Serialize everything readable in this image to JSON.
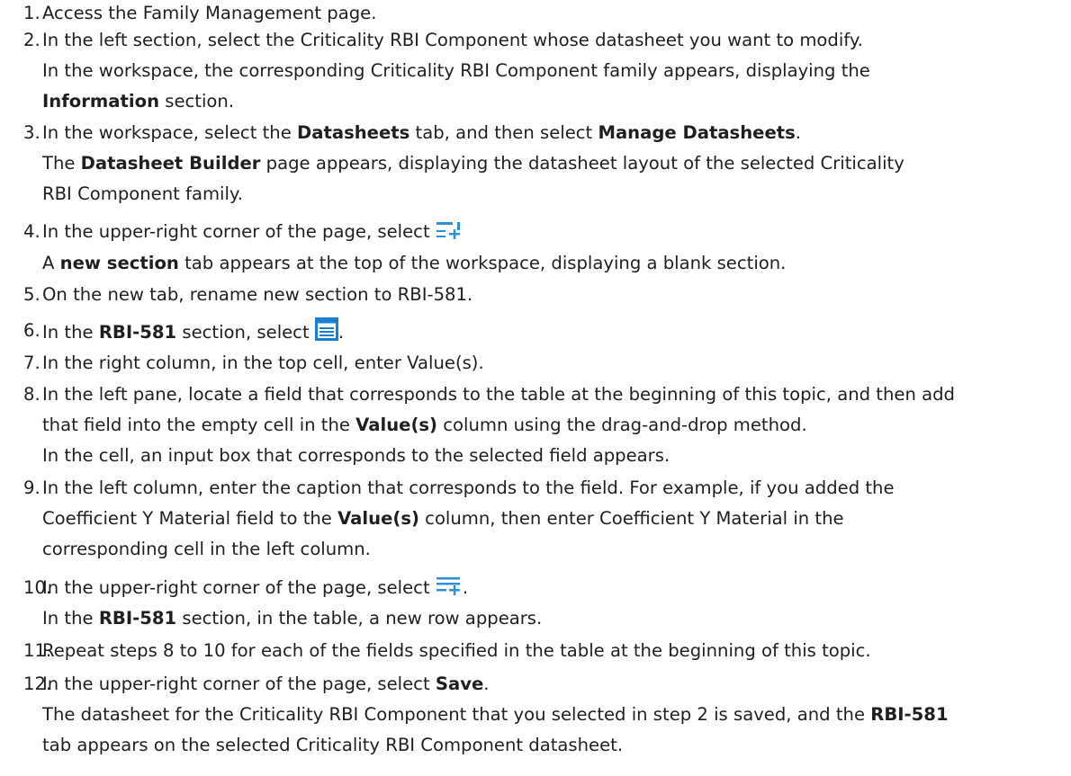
{
  "steps": [
    {
      "number": "1.",
      "lines": [
        [
          {
            "t": "Access the Family Management page."
          }
        ]
      ]
    },
    {
      "number": "2.",
      "lines": [
        [
          {
            "t": "In the left section, select the Criticality RBI Component whose datasheet you want to modify."
          }
        ],
        [
          {
            "t": "In the workspace, the corresponding Criticality RBI Component family appears, displaying the"
          }
        ],
        [
          {
            "t": "Information",
            "b": true
          },
          {
            "t": " section."
          }
        ]
      ]
    },
    {
      "number": "3.",
      "lines": [
        [
          {
            "t": "In the workspace, select the "
          },
          {
            "t": "Datasheets",
            "b": true
          },
          {
            "t": " tab, and then select "
          },
          {
            "t": "Manage Datasheets",
            "b": true
          },
          {
            "t": "."
          }
        ],
        [
          {
            "t": "The "
          },
          {
            "t": "Datasheet Builder",
            "b": true
          },
          {
            "t": " page appears, displaying the datasheet layout of the selected Criticality"
          }
        ],
        [
          {
            "t": "RBI Component family."
          }
        ]
      ]
    },
    {
      "number": "4.",
      "lines": [
        [
          {
            "t": "In the upper-right corner of the page, select "
          },
          {
            "icon": "add-section-icon"
          }
        ],
        [
          {
            "t": "A "
          },
          {
            "t": "new section",
            "b": true
          },
          {
            "t": " tab appears at the top of the workspace, displaying a blank section."
          }
        ]
      ]
    },
    {
      "number": "5.",
      "lines": [
        [
          {
            "t": "On the new tab, rename new section to RBI-581."
          }
        ]
      ]
    },
    {
      "number": "6.",
      "lines": [
        [
          {
            "t": "In the "
          },
          {
            "t": "RBI-581",
            "b": true
          },
          {
            "t": " section, select "
          },
          {
            "icon": "table-icon"
          },
          {
            "t": "."
          }
        ]
      ]
    },
    {
      "number": "7.",
      "lines": [
        [
          {
            "t": "In the right column, in the top cell, enter Value(s)."
          }
        ]
      ]
    },
    {
      "number": "8.",
      "lines": [
        [
          {
            "t": "In the left pane, locate a field that corresponds to the table at the beginning of this topic, and then add"
          }
        ],
        [
          {
            "t": "that field into the empty cell in the "
          },
          {
            "t": "Value(s)",
            "b": true
          },
          {
            "t": " column using the drag-and-drop method."
          }
        ],
        [
          {
            "t": "In the cell, an input box that corresponds to the selected field appears."
          }
        ]
      ]
    },
    {
      "number": "9.",
      "lines": [
        [
          {
            "t": "In the left column, enter the caption that corresponds to the field. For example, if you added the"
          }
        ],
        [
          {
            "t": "Coefficient Y Material field to the "
          },
          {
            "t": "Value(s)",
            "b": true
          },
          {
            "t": " column, then enter Coefficient Y Material in the"
          }
        ],
        [
          {
            "t": "corresponding cell in the left column."
          }
        ]
      ]
    },
    {
      "number": "10.",
      "lines": [
        [
          {
            "t": "In the upper-right corner of the page, select "
          },
          {
            "icon": "add-row-icon"
          },
          {
            "t": "."
          }
        ],
        [
          {
            "t": "In the "
          },
          {
            "t": "RBI-581",
            "b": true
          },
          {
            "t": " section, in the table, a new row appears."
          }
        ]
      ]
    },
    {
      "number": "11.",
      "lines": [
        [
          {
            "t": "Repeat steps 8 to 10 for each of the fields specified in the table at the beginning of this topic."
          }
        ]
      ]
    },
    {
      "number": "12.",
      "lines": [
        [
          {
            "t": "In the upper-right corner of the page, select "
          },
          {
            "t": "Save",
            "b": true
          },
          {
            "t": "."
          }
        ],
        [
          {
            "t": "The datasheet for the Criticality RBI Component that you selected in step 2 is saved, and the "
          },
          {
            "t": "RBI-581",
            "b": true
          }
        ],
        [
          {
            "t": "tab appears on the selected Criticality RBI Component datasheet."
          }
        ]
      ]
    }
  ]
}
